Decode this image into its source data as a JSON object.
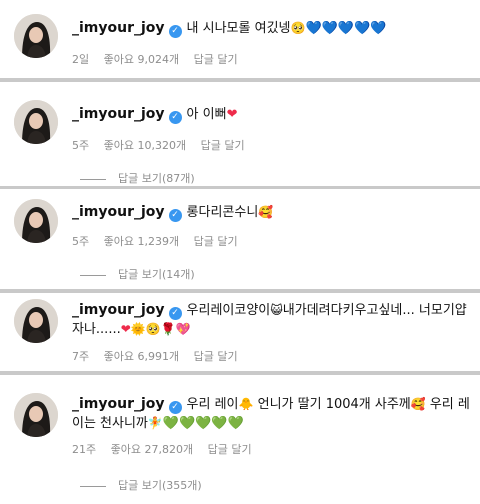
{
  "comments": [
    {
      "username": "_imyour_joy",
      "text": "내 시나모롤 여깄넹",
      "emoji": "🥺",
      "hearts": "💙💙💙💙💙",
      "time": "2일",
      "likes": "좋아요 9,024개",
      "reply": "답글 달기"
    },
    {
      "username": "_imyour_joy",
      "text": "아 이뻐",
      "hearts": "❤",
      "time": "5주",
      "likes": "좋아요 10,320개",
      "reply": "답글 달기",
      "view_replies": "답글 보기(87개)"
    },
    {
      "username": "_imyour_joy",
      "text": "롱다리콘수니",
      "emoji": "🥰",
      "time": "5주",
      "likes": "좋아요 1,239개",
      "reply": "답글 달기",
      "view_replies": "답글 보기(14개)"
    },
    {
      "username": "_imyour_joy",
      "text_a": "우리레이코양이",
      "emoji_a": "😺",
      "text_b": "내가데려다키우고싶네... 너모기얍자나......",
      "emoji_b": "❤🌞🥺🌹💖",
      "time": "7주",
      "likes": "좋아요 6,991개",
      "reply": "답글 달기"
    },
    {
      "username": "_imyour_joy",
      "text_a": "우리 레이",
      "emoji_a": "🐥",
      "text_b": "언니가 딸기 1004개 사주께",
      "emoji_b": "🥰",
      "text_c": "우리 레이는 천사니까",
      "emoji_c": "🧚",
      "hearts": "💚💚💚💚💚",
      "time": "21주",
      "likes": "좋아요 27,820개",
      "reply": "답글 달기",
      "view_replies": "답글 보기(355개)"
    }
  ],
  "colors": {
    "verified": "#3897f0",
    "meta_text": "#8e8e8e",
    "divider_bg": "#c9c9c9"
  }
}
